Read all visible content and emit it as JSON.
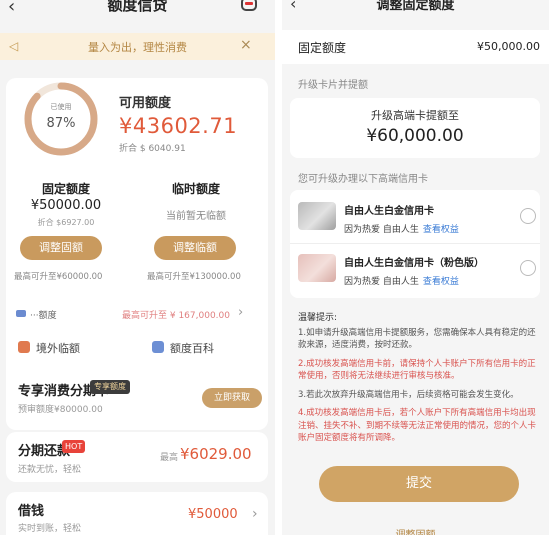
{
  "left": {
    "header": {
      "back": "‹",
      "title": "额度信贷"
    },
    "notice": {
      "text": "量入为出，理性消费",
      "close": "×"
    },
    "usage": {
      "ring_label": "已使用",
      "percent_value": 87,
      "percent_text": "87%",
      "available_label": "可用额度",
      "available_value": "¥43602.71",
      "available_sub": "折合 $ 6040.91"
    },
    "fixed": {
      "title": "固定额度",
      "value": "¥50000.00",
      "sub": "折合 $6927.00",
      "button": "调整固额",
      "max": "最高可升至¥60000.00"
    },
    "temp": {
      "title": "临时额度",
      "none": "当前暂无临额",
      "button": "调整临额",
      "max": "最高可升至¥130000.00"
    },
    "strip": {
      "text1": "···额度",
      "text2": "最高可升至 ¥ 167,000.00",
      "arrow": "›"
    },
    "quick": [
      {
        "label": "境外临额"
      },
      {
        "label": "额度百科"
      }
    ],
    "rows": [
      {
        "title": "专享消费分期卡",
        "tag": "专享额度",
        "sub": "预审额度¥80000.00",
        "button": "立即获取"
      },
      {
        "title": "分期还款",
        "hot": "HOT",
        "sub": "还款无忧，轻松",
        "prefix": "最高",
        "value": "¥6029.00"
      },
      {
        "title": "借钱",
        "sub": "实时到账，轻松",
        "value": "¥50000",
        "chevron": "›"
      }
    ]
  },
  "right": {
    "header": {
      "back": "‹",
      "title": "调整固定额度"
    },
    "fixed": {
      "label": "固定额度",
      "value": "¥50,000.00"
    },
    "upgrade_label": "升级卡片并提额",
    "quota": {
      "line1": "升级高端卡提额至",
      "value": "¥60,000.00"
    },
    "cards_label": "您可升级办理以下高端信用卡",
    "cards": [
      {
        "name": "自由人生白金信用卡",
        "desc": "因为热爱 自由人生",
        "link": "查看权益"
      },
      {
        "name": "自由人生白金信用卡（粉色版）",
        "desc": "因为热爱 自由人生",
        "link": "查看权益"
      }
    ],
    "tips": {
      "title": "温馨提示:",
      "items": [
        "1.如申请升级高端信用卡提额服务，您需确保本人具有稳定的还款来源，适度消费，按时还款。",
        "2.成功核发高端信用卡前，请保持个人卡账户下所有信用卡的正常使用，否则将无法继续进行审核与核准。",
        "3.若此次放弃升级高端信用卡，后续资格可能会发生变化。",
        "4.成功核发高端信用卡后，若个人账户下所有高端信用卡均出现注销、挂失不补、到期不续等无法正常使用的情况，您的个人卡账户固定额度将有所调降。"
      ]
    },
    "submit": "提交",
    "bottom_link": "调整固额"
  },
  "colors": {
    "accent_gold": "#c99a5e",
    "amount_red": "#e05a3a",
    "notice_bg": "#fbf0dc",
    "link_blue": "#3a7bd5",
    "hot_red": "#e8433a"
  }
}
